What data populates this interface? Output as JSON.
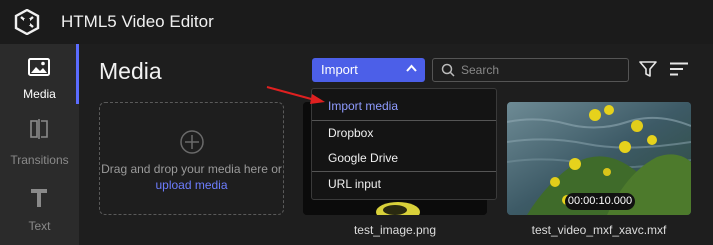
{
  "app": {
    "title": "HTML5 Video Editor"
  },
  "sidebar": {
    "items": [
      {
        "label": "Media",
        "icon": "image-icon",
        "active": true
      },
      {
        "label": "Transitions",
        "icon": "transitions-icon",
        "active": false
      },
      {
        "label": "Text",
        "icon": "text-icon",
        "active": false
      }
    ]
  },
  "main": {
    "heading": "Media",
    "import_label": "Import",
    "search_placeholder": "Search",
    "dropzone": {
      "text": "Drag and drop your media here or",
      "link": "upload media"
    },
    "media": [
      {
        "name": "test_image.png"
      },
      {
        "name": "test_video_mxf_xavc.mxf",
        "duration": "00:00:10.000"
      }
    ]
  },
  "import_menu": {
    "items": [
      "Import media",
      "Dropbox",
      "Google Drive",
      "URL input"
    ]
  },
  "colors": {
    "accent": "#4c5fe8",
    "link": "#6d7dff",
    "annotation_arrow": "#e02020"
  }
}
